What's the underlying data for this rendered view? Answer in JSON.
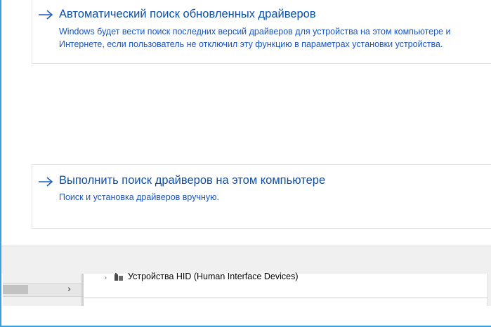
{
  "dialog": {
    "options": [
      {
        "title": "Автоматический поиск обновленных драйверов",
        "description_line1": "Windows будет вести поиск последних версий драйверов для устройства на этом компьютере и",
        "description_line2": "Интернете, если пользователь не отключил эту функцию в параметрах установки устройства.",
        "icon": "arrow-right-icon"
      },
      {
        "title": "Выполнить поиск драйверов на этом компьютере",
        "description_line1": "Поиск и установка драйверов вручную.",
        "icon": "arrow-right-icon"
      }
    ]
  },
  "background_window": {
    "tree_item_label": "Устройства HID (Human Interface Devices)",
    "expander_glyph": "›",
    "scroll_right_glyph": "›"
  },
  "colors": {
    "accent": "#0b4fa8",
    "frame_border": "#3aa0e0",
    "footer_bg": "#f0f0f0"
  }
}
